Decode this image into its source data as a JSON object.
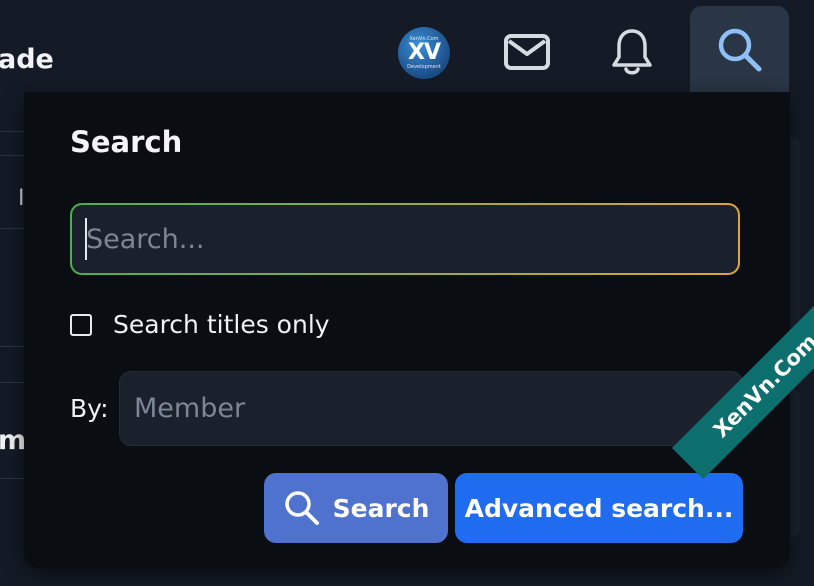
{
  "background": {
    "title_fragment": "ade",
    "cell_fragment": "I",
    "title_fragment_2": "m"
  },
  "header": {
    "logo": {
      "text_small": "XenVn.Com",
      "text_main": "XV",
      "text_sub": "Development"
    },
    "icons": [
      "mail-icon",
      "bell-icon",
      "search-icon"
    ]
  },
  "popup": {
    "title": "Search",
    "search_input": {
      "value": "",
      "placeholder": "Search..."
    },
    "titles_only": {
      "label": "Search titles only",
      "checked": false
    },
    "by": {
      "label": "By:",
      "member_placeholder": "Member",
      "value": ""
    },
    "buttons": {
      "search_label": "Search",
      "advanced_label": "Advanced search..."
    }
  },
  "watermark": {
    "text": "XenVn.Com"
  },
  "colors": {
    "popup_bg": "#0a0e13",
    "input_bg": "#1a212c",
    "search_button": "#5072cf",
    "advanced_button": "#1f6cf0",
    "focus_gradient_start": "#4caf50",
    "focus_gradient_end": "#e0a33a"
  }
}
